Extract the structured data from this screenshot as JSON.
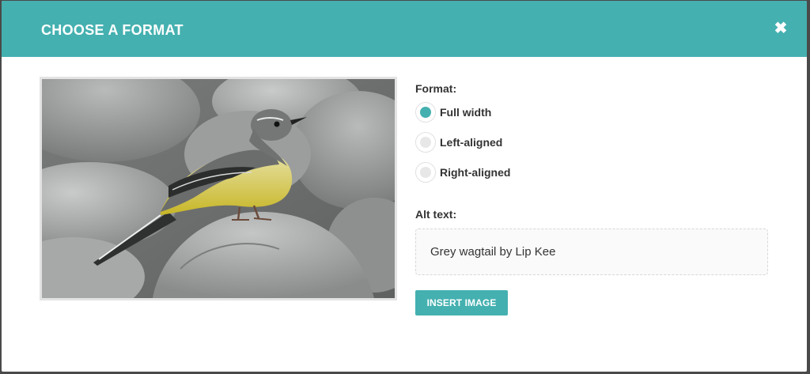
{
  "modal": {
    "title": "CHOOSE A FORMAT",
    "close_icon": "close-icon",
    "close_glyph": "✖"
  },
  "preview": {
    "subject": "grey wagtail photo"
  },
  "form": {
    "format_label": "Format:",
    "options": [
      {
        "label": "Full width",
        "checked": true
      },
      {
        "label": "Left-aligned",
        "checked": false
      },
      {
        "label": "Right-aligned",
        "checked": false
      }
    ],
    "alt_label": "Alt text:",
    "alt_value": "Grey wagtail by Lip Kee",
    "insert_label": "INSERT IMAGE"
  },
  "colors": {
    "accent": "#45b0b0",
    "overlay": "#4a4a4a",
    "radio_unchecked": "#e7e7e7"
  }
}
